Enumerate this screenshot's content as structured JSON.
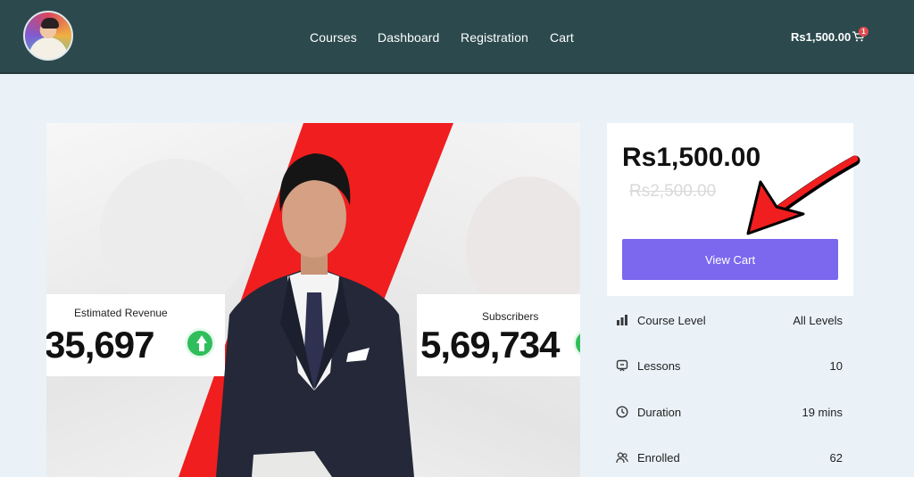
{
  "header": {
    "avatar_icon": "user-avatar-icon",
    "nav": {
      "courses": "Courses",
      "dashboard": "Dashboard",
      "registration": "Registration",
      "cart": "Cart"
    },
    "cart_total": "Rs1,500.00",
    "cart_count": "1",
    "cart_icon": "shopping-cart-icon"
  },
  "thumbnail": {
    "left_stat": {
      "label": "Estimated Revenue",
      "value": "35,697"
    },
    "right_stat": {
      "label": "Subscribers",
      "value": "5,69,734"
    },
    "up_icon": "arrow-up-circle-icon"
  },
  "pricing": {
    "price": "Rs1,500.00",
    "old_price": "Rs2,500.00",
    "button_label": "View Cart"
  },
  "course_info": [
    {
      "label": "Course Level",
      "value": "All Levels",
      "icon": "bar-chart-icon"
    },
    {
      "label": "Lessons",
      "value": "10",
      "icon": "book-icon"
    },
    {
      "label": "Duration",
      "value": "19 mins",
      "icon": "clock-icon"
    },
    {
      "label": "Enrolled",
      "value": "62",
      "icon": "users-icon"
    }
  ],
  "colors": {
    "header_bg": "#2c4a4e",
    "page_bg": "#eaf2f8",
    "button": "#7b68ee",
    "accent_red": "#f01e1e",
    "badge": "#e5484d"
  }
}
